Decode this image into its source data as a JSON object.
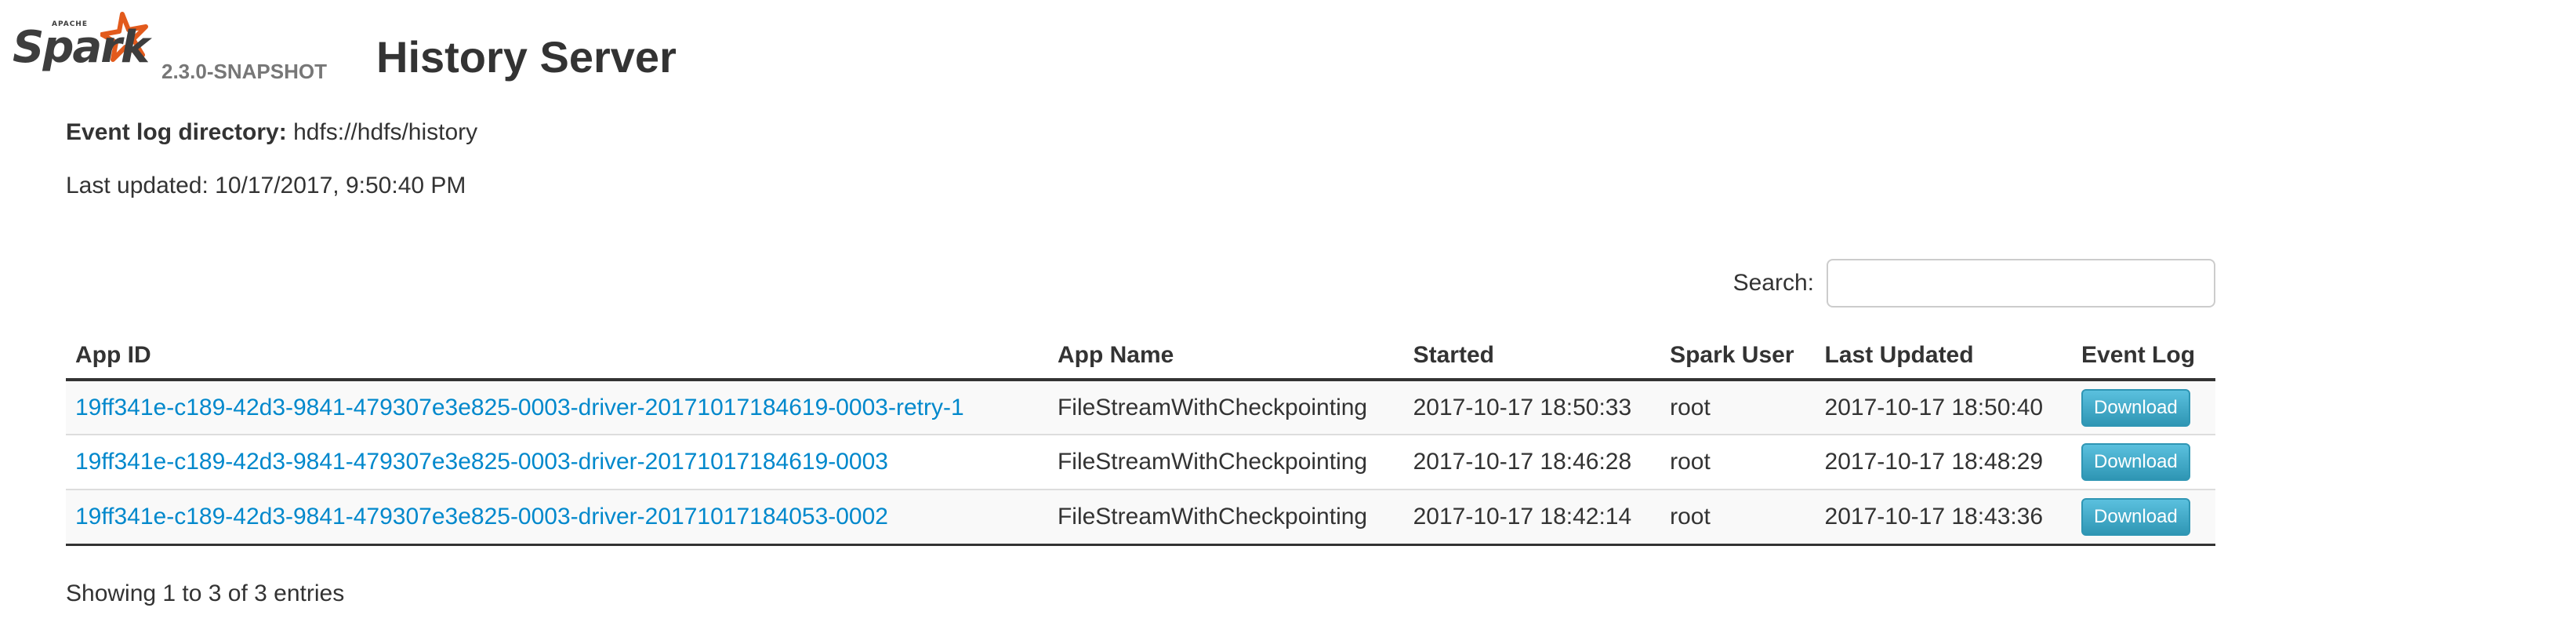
{
  "header": {
    "logo_apache": "APACHE",
    "logo_spark": "Spark",
    "version": "2.3.0-SNAPSHOT",
    "title": "History Server"
  },
  "info": {
    "event_log_label": "Event log directory:",
    "event_log_value": "hdfs://hdfs/history",
    "last_updated": "Last updated: 10/17/2017, 9:50:40 PM"
  },
  "search": {
    "label": "Search:",
    "value": ""
  },
  "table": {
    "columns": [
      "App ID",
      "App Name",
      "Started",
      "Spark User",
      "Last Updated",
      "Event Log"
    ],
    "rows": [
      {
        "app_id": "19ff341e-c189-42d3-9841-479307e3e825-0003-driver-20171017184619-0003-retry-1",
        "app_name": "FileStreamWithCheckpointing",
        "started": "2017-10-17 18:50:33",
        "spark_user": "root",
        "last_updated": "2017-10-17 18:50:40",
        "event_log": "Download"
      },
      {
        "app_id": "19ff341e-c189-42d3-9841-479307e3e825-0003-driver-20171017184619-0003",
        "app_name": "FileStreamWithCheckpointing",
        "started": "2017-10-17 18:46:28",
        "spark_user": "root",
        "last_updated": "2017-10-17 18:48:29",
        "event_log": "Download"
      },
      {
        "app_id": "19ff341e-c189-42d3-9841-479307e3e825-0003-driver-20171017184053-0002",
        "app_name": "FileStreamWithCheckpointing",
        "started": "2017-10-17 18:42:14",
        "spark_user": "root",
        "last_updated": "2017-10-17 18:43:36",
        "event_log": "Download"
      }
    ]
  },
  "footer": {
    "entries_info": "Showing 1 to 3 of 3 entries"
  },
  "colors": {
    "link": "#0088cc",
    "logo_star": "#e25a1c",
    "button": "#49afcd"
  },
  "icons": {
    "logo": "spark-logo-icon",
    "star": "star-icon"
  }
}
